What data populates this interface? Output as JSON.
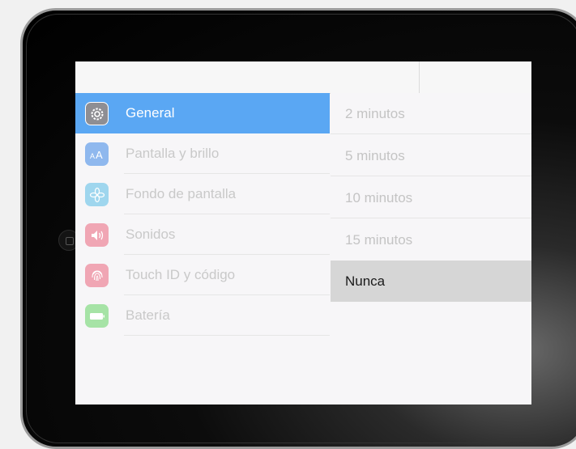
{
  "sidebar": {
    "items": [
      {
        "label": "General",
        "icon": "gear-icon",
        "color": "#8e8e93",
        "selected": true
      },
      {
        "label": "Pantalla y brillo",
        "icon": "text-size-icon",
        "color": "#8fb8ee"
      },
      {
        "label": "Fondo de pantalla",
        "icon": "flower-icon",
        "color": "#9fd6ee"
      },
      {
        "label": "Sonidos",
        "icon": "speaker-icon",
        "color": "#f0a6b4"
      },
      {
        "label": "Touch ID y código",
        "icon": "fingerprint-icon",
        "color": "#f0a6b4"
      },
      {
        "label": "Batería",
        "icon": "battery-icon",
        "color": "#a6e3a6"
      }
    ],
    "selected_color": "#5aa7f3"
  },
  "options": {
    "items": [
      {
        "label": "2 minutos"
      },
      {
        "label": "5 minutos"
      },
      {
        "label": "10 minutos"
      },
      {
        "label": "15 minutos"
      },
      {
        "label": "Nunca",
        "selected": true
      }
    ]
  }
}
